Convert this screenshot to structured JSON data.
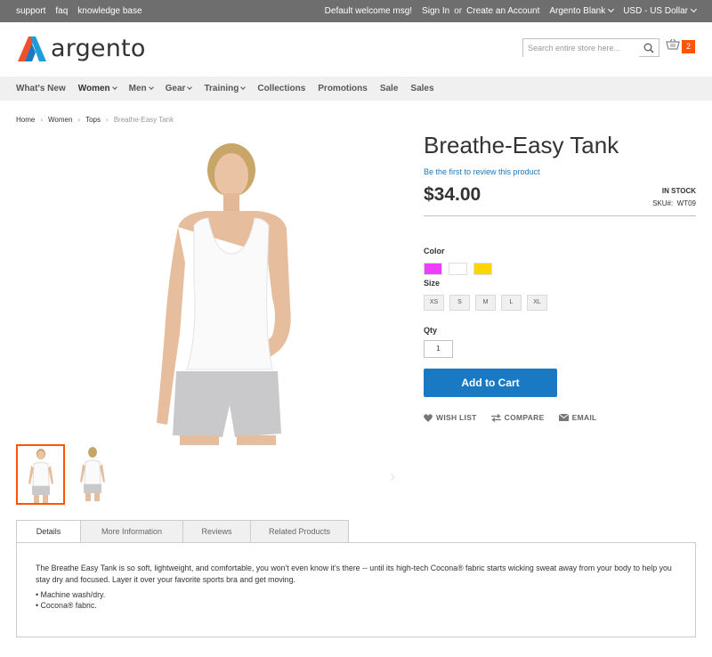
{
  "topbar": {
    "links": [
      "support",
      "faq",
      "knowledge base"
    ],
    "welcome": "Default welcome msg!",
    "sign_in": "Sign In",
    "or": "or",
    "create_account": "Create an Account",
    "theme": "Argento Blank",
    "currency": "USD - US Dollar"
  },
  "header": {
    "logo_text": "argento",
    "search_placeholder": "Search entire store here...",
    "cart_count": "2"
  },
  "nav": [
    {
      "label": "What's New"
    },
    {
      "label": "Women"
    },
    {
      "label": "Men"
    },
    {
      "label": "Gear"
    },
    {
      "label": "Training"
    },
    {
      "label": "Collections"
    },
    {
      "label": "Promotions"
    },
    {
      "label": "Sale"
    },
    {
      "label": "Sales"
    }
  ],
  "breadcrumb": [
    "Home",
    "Women",
    "Tops",
    "Breathe-Easy Tank"
  ],
  "product": {
    "title": "Breathe-Easy Tank",
    "review_link": "Be the first to review this product",
    "price": "$34.00",
    "stock": "IN STOCK",
    "sku_label": "SKU#:",
    "sku": "WT09",
    "color_label": "Color",
    "colors": [
      "#ef3dff",
      "#ffffff",
      "#ffd500"
    ],
    "size_label": "Size",
    "sizes": [
      "XS",
      "S",
      "M",
      "L",
      "XL"
    ],
    "qty_label": "Qty",
    "qty": "1",
    "add_to_cart": "Add to Cart",
    "wishlist": "WISH LIST",
    "compare": "COMPARE",
    "email": "EMAIL"
  },
  "tabs": {
    "items": [
      "Details",
      "More Information",
      "Reviews",
      "Related Products"
    ],
    "details_text": "The Breathe Easy Tank is so soft, lightweight, and comfortable, you won't even know it's there -- until its high-tech Cocona® fabric starts wicking sweat away from your body to help you stay dry and focused. Layer it over your favorite sports bra and get moving.",
    "bullets": [
      "• Machine wash/dry.",
      "• Cocona® fabric."
    ]
  },
  "colors": {
    "accent_orange": "#ff5501",
    "primary_blue": "#1979c3",
    "topbar_bg": "#6e6e6e"
  }
}
